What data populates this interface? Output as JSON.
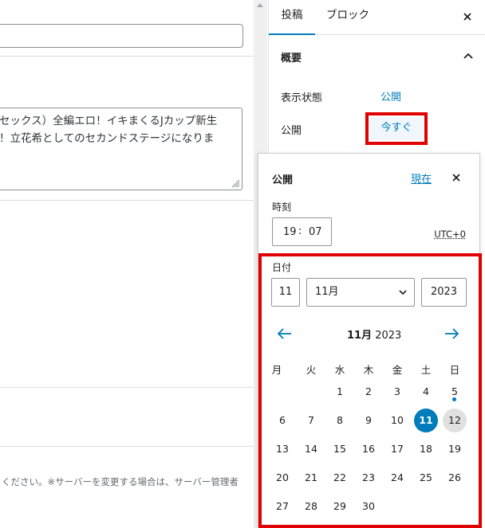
{
  "editor": {
    "excerpt_lines": [
      "セックス）全編エロ！イキまくるJカップ新生",
      "！立花希としてのセカンドステージになりま"
    ],
    "note": "ください。※サーバーを変更する場合は、サーバー管理者"
  },
  "sidebar": {
    "tabs": [
      "投稿",
      "ブロック"
    ],
    "panel_title": "概要",
    "visibility_label": "表示状態",
    "visibility_value": "公開",
    "publish_label": "公開",
    "publish_value": "今すぐ"
  },
  "popover": {
    "title": "公開",
    "now_link": "現在",
    "time_label": "時刻",
    "hour": "19",
    "minute": "07",
    "time_sep": ":",
    "timezone": "UTC+0",
    "date_label": "日付",
    "day": "11",
    "month": "11月",
    "year": "2023",
    "calendar_month": "11月",
    "calendar_year": "2023",
    "weekdays": [
      "月",
      "火",
      "水",
      "木",
      "金",
      "土",
      "日"
    ],
    "weeks": [
      [
        "",
        "",
        "1",
        "2",
        "3",
        "4",
        "5"
      ],
      [
        "6",
        "7",
        "8",
        "9",
        "10",
        "11",
        "12"
      ],
      [
        "13",
        "14",
        "15",
        "16",
        "17",
        "18",
        "19"
      ],
      [
        "20",
        "21",
        "22",
        "23",
        "24",
        "25",
        "26"
      ],
      [
        "27",
        "28",
        "29",
        "30",
        "",
        "",
        ""
      ]
    ],
    "selected_day": "11",
    "today_day": "12",
    "event_day": "5"
  },
  "colors": {
    "accent": "#007cba",
    "highlight": "#e00000",
    "today_bg": "#e0e0e0"
  }
}
